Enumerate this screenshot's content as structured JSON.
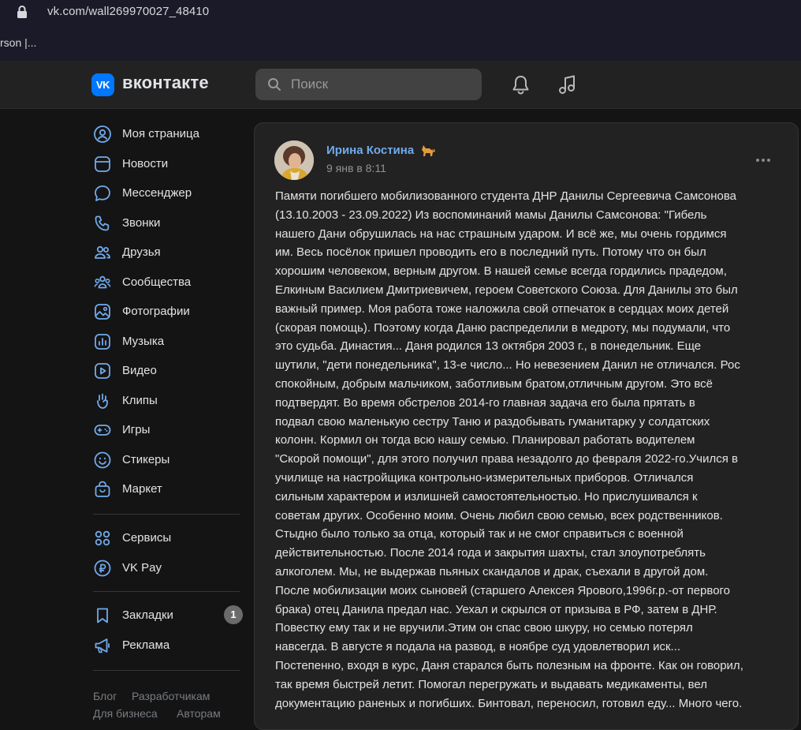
{
  "browser": {
    "url": "vk.com/wall269970027_48410",
    "bookmark": "rson |..."
  },
  "header": {
    "logo_mark": "VK",
    "logo_text": "вконтакте",
    "search_placeholder": "Поиск"
  },
  "sidebar": {
    "items": [
      {
        "label": "Моя страница",
        "icon": "user-circle-icon"
      },
      {
        "label": "Новости",
        "icon": "news-icon"
      },
      {
        "label": "Мессенджер",
        "icon": "message-icon"
      },
      {
        "label": "Звонки",
        "icon": "phone-icon"
      },
      {
        "label": "Друзья",
        "icon": "friends-icon"
      },
      {
        "label": "Сообщества",
        "icon": "communities-icon"
      },
      {
        "label": "Фотографии",
        "icon": "photo-icon"
      },
      {
        "label": "Музыка",
        "icon": "music-icon"
      },
      {
        "label": "Видео",
        "icon": "video-icon"
      },
      {
        "label": "Клипы",
        "icon": "clips-icon"
      },
      {
        "label": "Игры",
        "icon": "gamepad-icon"
      },
      {
        "label": "Стикеры",
        "icon": "sticker-icon"
      },
      {
        "label": "Маркет",
        "icon": "market-icon"
      },
      {
        "label": "Сервисы",
        "icon": "services-icon"
      },
      {
        "label": "VK Pay",
        "icon": "vkpay-icon"
      },
      {
        "label": "Закладки",
        "icon": "bookmark-icon",
        "badge": "1"
      },
      {
        "label": "Реклама",
        "icon": "megaphone-icon"
      }
    ],
    "footer": [
      "Блог",
      "Разработчикам",
      "Для бизнеса",
      "Авторам"
    ]
  },
  "post": {
    "author": "Ирина Костина",
    "author_emoji": "dog-icon",
    "time": "9 янв в 8:11",
    "lines": [
      "Памяти погибшего мобилизованного студента ДНР Данилы Сергеевича Самсонова",
      "(13.10.2003 - 23.09.2022) Из воспоминаний мамы Данилы Самсонова: \"Гибель",
      "нашего Дани обрушилась на нас страшным ударом. И всё же, мы очень гордимся",
      "им. Весь посёлок пришел проводить его в последний путь. Потому что он был",
      "хорошим человеком, верным другом. В нашей семье всегда гордились прадедом,",
      "Елкиным Василием Дмитриевичем, героем Советского Союза. Для Данилы это был",
      "важный пример. Моя работа тоже наложила свой отпечаток в сердцах моих детей",
      "(скорая помощь). Поэтому когда Даню распределили в медроту, мы подумали, что",
      "это судьба. Династия... Даня родился 13 октября 2003 г., в понедельник. Еще",
      "шутили, \"дети понедельника\", 13-е число... Но невезением Данил не отличался. Рос",
      "спокойным, добрым мальчиком, заботливым братом,отличным другом. Это всё",
      "подтвердят. Во время обстрелов 2014-го главная задача его была прятать в",
      "подвал свою маленькую сестру Таню и раздобывать гуманитарку у солдатских",
      "колонн. Кормил он тогда всю нашу семью. Планировал работать водителем",
      "\"Скорой помощи\", для этого получил права незадолго до февраля 2022-го.Учился в",
      "училище на настройщика контрольно-измерительных приборов. Отличался",
      "сильным характером и излишней самостоятельностью. Но прислушивался к",
      "советам других. Особенно моим. Очень любил свою семью, всех родственников.",
      "Стыдно было только за отца, который так и не смог справиться с военной",
      "действительностью. После 2014 года и закрытия шахты, стал злоупотреблять",
      "алкоголем. Мы, не выдержав пьяных скандалов и драк, съехали в другой дом.",
      "После мобилизации моих сыновей (старшего Алексея Ярового,1996г.р.-от первого",
      "брака) отец Данила предал нас. Уехал и скрылся от призыва в РФ, затем в ДНР.",
      "Повестку ему так и не вручили.Этим он спас свою шкуру, но семью потерял",
      "навсегда. В августе я подала на развод, в ноябре суд удовлетворил иск...",
      "Постепенно, входя в курс, Даня старался быть полезным на фронте. Как он говорил,",
      "так время быстрей летит. Помогал перегружать и выдавать медикаменты, вел",
      "документацию раненых и погибших. Бинтовал, переносил, готовил еду... Много чего."
    ]
  },
  "colors": {
    "accent": "#0077ff",
    "link": "#71aaeb",
    "background": "#141414",
    "card": "#222222"
  }
}
